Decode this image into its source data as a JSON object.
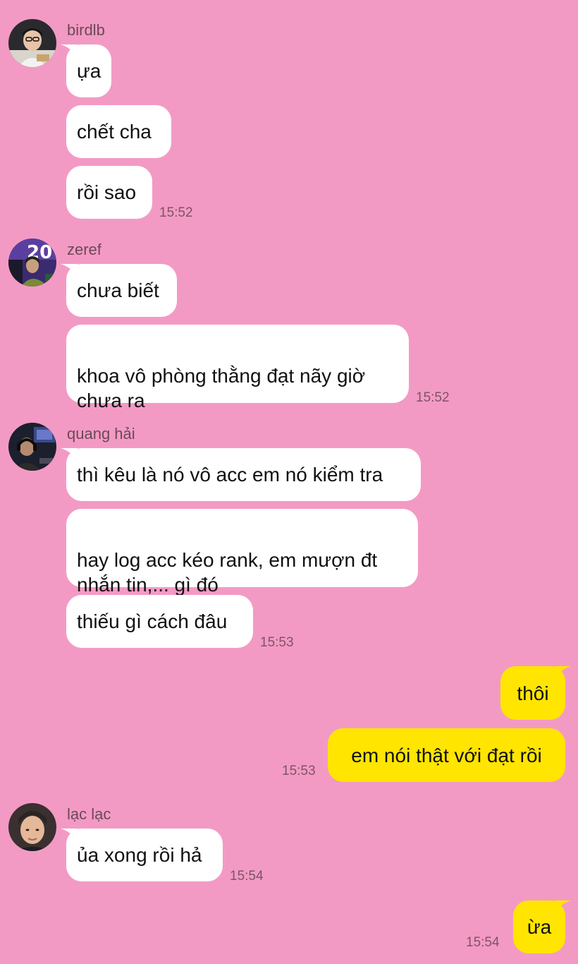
{
  "groups": [
    {
      "sender": "birdlb",
      "messages": [
        "ựa",
        "chết cha",
        "rồi sao"
      ],
      "time": "15:52"
    },
    {
      "sender": "zeref",
      "messages": [
        "chưa biết",
        "khoa vô phòng thằng đạt nãy giờ\nchưa ra"
      ],
      "time": "15:52"
    },
    {
      "sender": "quang hải",
      "messages": [
        "thì kêu là nó vô acc em nó kiểm tra",
        "hay log acc kéo rank, em mượn đt\nnhắn tin,... gì đó",
        "thiếu gì cách đâu"
      ],
      "time": "15:53"
    },
    {
      "messages": [
        "thôi",
        "em nói thật với đạt rồi"
      ],
      "time": "15:53"
    },
    {
      "sender": "lạc lạc",
      "messages": [
        "ủa xong rồi hả"
      ],
      "time": "15:54"
    },
    {
      "messages": [
        "ừa"
      ],
      "time": "15:54"
    }
  ],
  "colors": {
    "background": "#F39AC4",
    "incoming_bubble": "#FFFFFF",
    "outgoing_bubble": "#FFE500",
    "sender_name": "#6B4A58",
    "timestamp": "#7B5564"
  }
}
